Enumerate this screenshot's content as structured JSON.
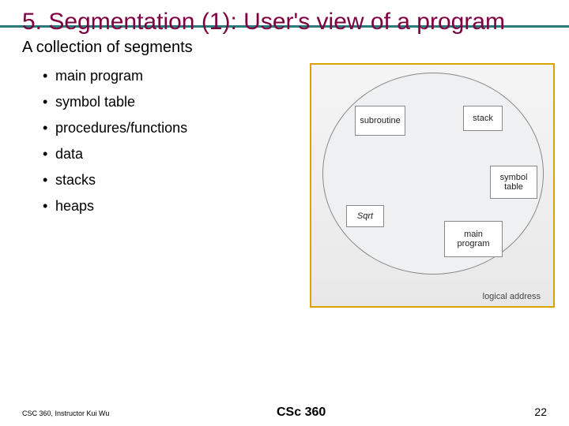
{
  "title": "5. Segmentation (1): User's view of a program",
  "subhead": "A collection of segments",
  "bullets": [
    "main program",
    "symbol table",
    "procedures/functions",
    "data",
    "stacks",
    "heaps"
  ],
  "diagram": {
    "boxes": {
      "subroutine": "subroutine",
      "stack": "stack",
      "symbol": "symbol table",
      "sqrt": "Sqrt",
      "main": "main program"
    },
    "caption": "logical address"
  },
  "footer": {
    "left": "CSC 360, Instructor Kui Wu",
    "center": "CSc 360",
    "page": "22"
  }
}
